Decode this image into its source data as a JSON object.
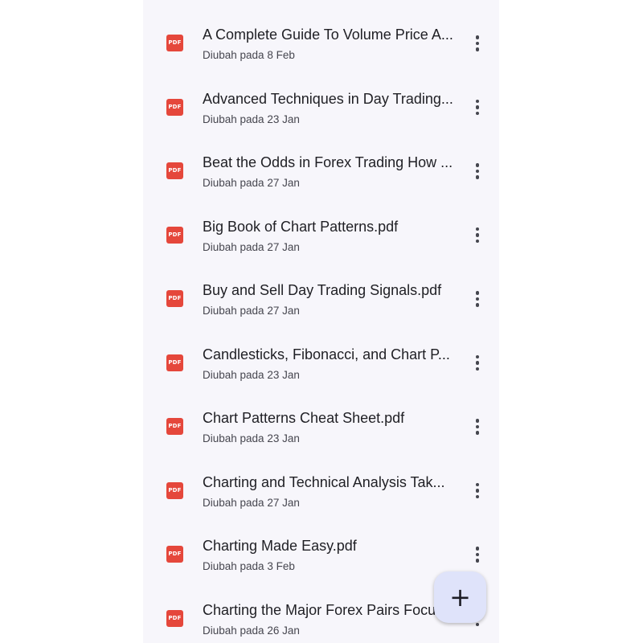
{
  "colors": {
    "screen_bg": "#f7f6fb",
    "pdf_badge": "#e5473b",
    "title_text": "#1f1f24",
    "meta_text": "#46464f",
    "fab_bg": "#dfe3fa"
  },
  "icons": {
    "file": "pdf-icon",
    "more": "more-vertical-icon",
    "fab": "plus-icon"
  },
  "pdf_badge_label": "PDF",
  "files": [
    {
      "name": "A Complete Guide To Volume Price A...",
      "modified": "Diubah pada 8 Feb"
    },
    {
      "name": "Advanced Techniques in Day Trading...",
      "modified": "Diubah pada 23 Jan"
    },
    {
      "name": "Beat the Odds in Forex Trading How ...",
      "modified": "Diubah pada 27 Jan"
    },
    {
      "name": "Big Book of Chart Patterns.pdf",
      "modified": "Diubah pada 27 Jan"
    },
    {
      "name": "Buy and Sell Day Trading Signals.pdf",
      "modified": "Diubah pada 27 Jan"
    },
    {
      "name": "Candlesticks, Fibonacci, and Chart P...",
      "modified": "Diubah pada 23 Jan"
    },
    {
      "name": "Chart Patterns Cheat Sheet.pdf",
      "modified": "Diubah pada 23 Jan"
    },
    {
      "name": "Charting and Technical Analysis Tak...",
      "modified": "Diubah pada 27 Jan"
    },
    {
      "name": "Charting Made Easy.pdf",
      "modified": "Diubah pada 3 Feb"
    },
    {
      "name": "Charting the Major Forex Pairs Focu",
      "modified": "Diubah pada 26 Jan"
    }
  ],
  "fab": {
    "symbol": "+"
  }
}
